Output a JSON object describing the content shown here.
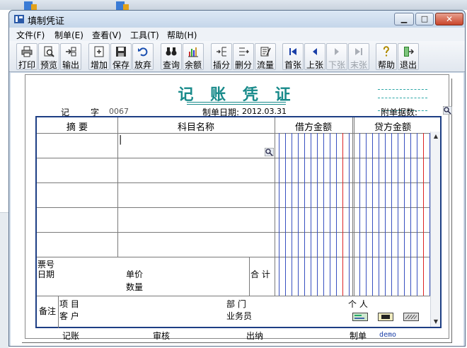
{
  "window": {
    "title": "填制凭证"
  },
  "menu": [
    {
      "label": "文件(F)"
    },
    {
      "label": "制单(E)"
    },
    {
      "label": "查看(V)"
    },
    {
      "label": "工具(T)"
    },
    {
      "label": "帮助(H)"
    }
  ],
  "toolbar": [
    {
      "label": "打印",
      "icon": "printer-icon"
    },
    {
      "label": "预览",
      "icon": "preview-icon"
    },
    {
      "label": "输出",
      "icon": "export-icon"
    },
    {
      "label": "增加",
      "icon": "add-icon"
    },
    {
      "label": "保存",
      "icon": "save-icon"
    },
    {
      "label": "放弃",
      "icon": "undo-icon"
    },
    {
      "label": "查询",
      "icon": "binoculars-icon"
    },
    {
      "label": "余额",
      "icon": "balance-chart-icon"
    },
    {
      "label": "插分",
      "icon": "insert-row-icon"
    },
    {
      "label": "删分",
      "icon": "delete-row-icon"
    },
    {
      "label": "流量",
      "icon": "cashflow-icon"
    },
    {
      "label": "首张",
      "icon": "first-record-icon"
    },
    {
      "label": "上张",
      "icon": "prev-record-icon"
    },
    {
      "label": "下张",
      "icon": "next-record-icon"
    },
    {
      "label": "末张",
      "icon": "last-record-icon"
    },
    {
      "label": "帮助",
      "icon": "help-icon"
    },
    {
      "label": "退出",
      "icon": "exit-icon"
    }
  ],
  "voucher": {
    "heading": "记 账 凭 证",
    "type_label": "记",
    "zi_label": "字",
    "number": "0067",
    "date_label": "制单日期:",
    "date": "2012.03.31",
    "attachments_label": "附单据数:",
    "columns": {
      "summary": "摘 要",
      "account": "科目名称",
      "debit": "借方金额",
      "credit": "贷方金额"
    },
    "bottom": {
      "ticket_no": "票号",
      "date": "日期",
      "unit_price": "单价",
      "quantity": "数量",
      "total": "合 计",
      "remark": "备注",
      "project": "项  目",
      "customer": "客  户",
      "department": "部  门",
      "salesperson": "业务员",
      "person": "个  人"
    },
    "footer": {
      "posted_by": "记账",
      "audited_by": "审核",
      "cashier": "出纳",
      "prepared_by": "制单",
      "preparer_name": "demo"
    }
  },
  "colors": {
    "heading": "#188a8a",
    "grid_border": "#1d3e84",
    "amount_line": "#3850c0",
    "amount_red": "#d22222"
  }
}
